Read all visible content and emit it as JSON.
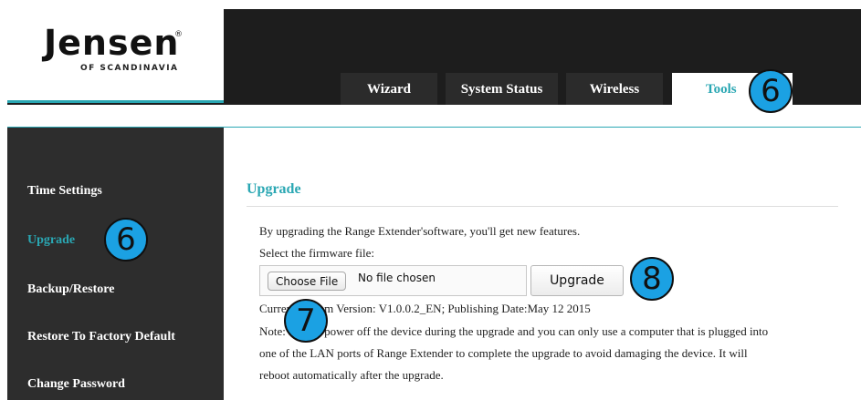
{
  "brand": {
    "name": "Jensen",
    "registered": "®",
    "tagline": "OF SCANDINAVIA"
  },
  "tabs": [
    {
      "label": "Wizard"
    },
    {
      "label": "System Status"
    },
    {
      "label": "Wireless"
    },
    {
      "label": "Tools",
      "active": true
    }
  ],
  "sidebar": {
    "items": [
      {
        "label": "Time Settings"
      },
      {
        "label": "Upgrade",
        "active": true
      },
      {
        "label": "Backup/Restore"
      },
      {
        "label": "Restore To Factory Default"
      },
      {
        "label": "Change Password"
      }
    ]
  },
  "main": {
    "title": "Upgrade",
    "intro": "By upgrading the Range Extender'software, you'll get new features.",
    "select_label": "Select the firmware file:",
    "choose_file_label": "Choose File",
    "no_file_text": "No file chosen",
    "upgrade_button": "Upgrade",
    "version_line": "Current System Version: V1.0.0.2_EN; Publishing Date:May 12 2015",
    "note_line1": "Note: Do not power off the device during the upgrade and you can only use a computer that is plugged into",
    "note_line2": "one of the LAN ports of Range Extender to complete the upgrade to avoid damaging the device. It will",
    "note_line3": "reboot automatically after the upgrade."
  },
  "callouts": {
    "tools": "6",
    "upgrade": "6",
    "choose_file": "7",
    "upgrade_button": "8"
  },
  "colors": {
    "accent": "#2aa7b3",
    "callout": "#1ba1e3",
    "header": "#1d1d1d",
    "sidebar": "#2d2d2d"
  }
}
